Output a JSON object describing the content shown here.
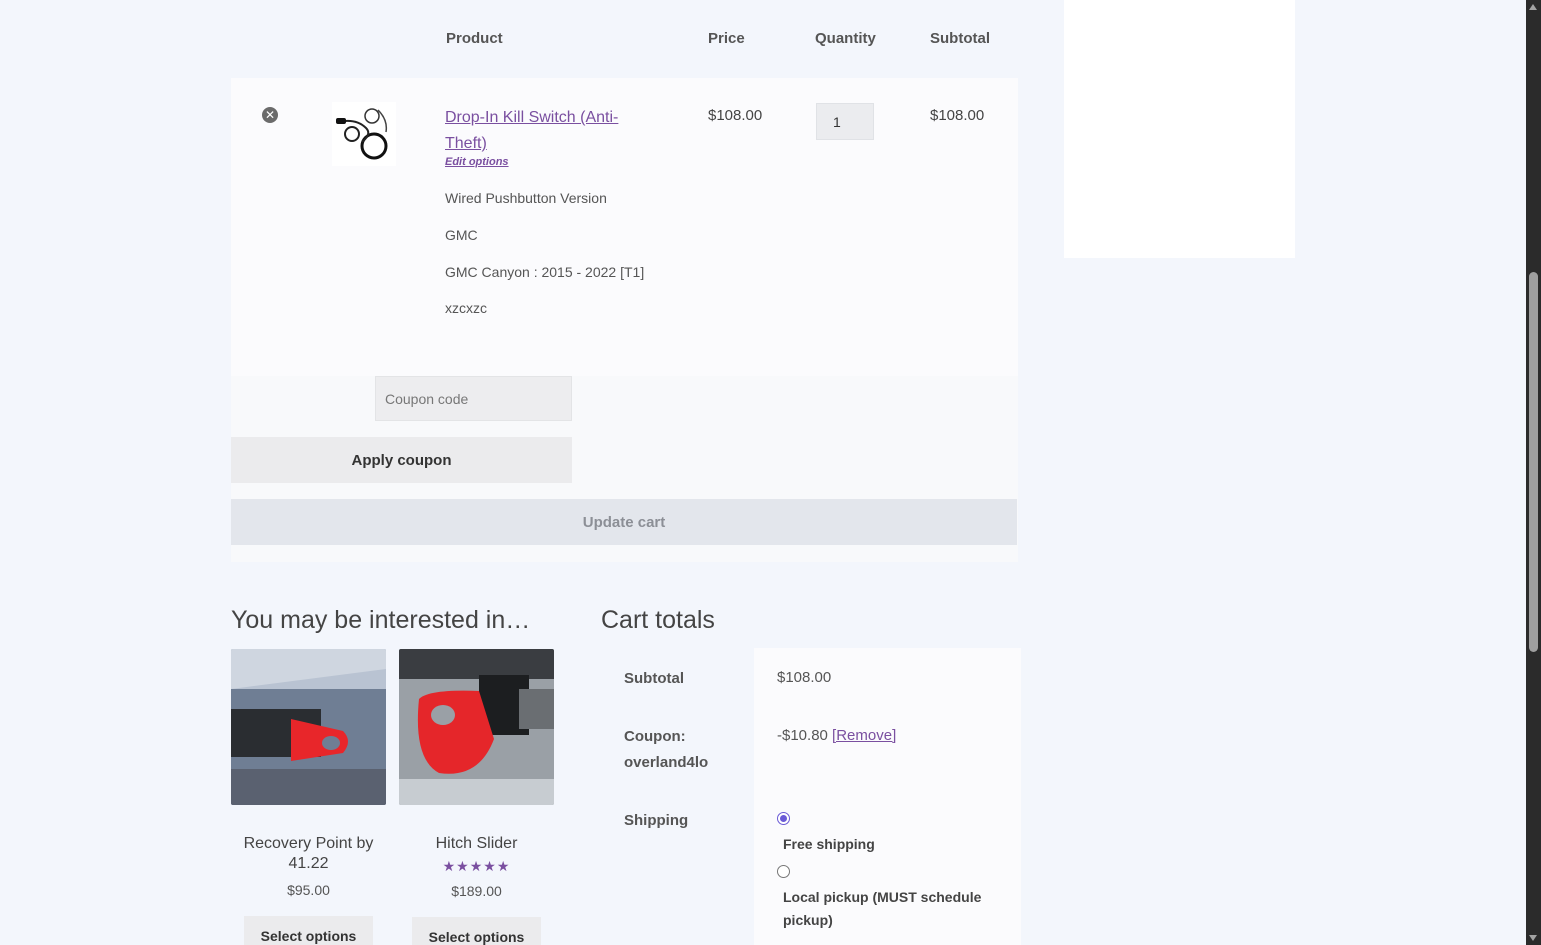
{
  "cart_table": {
    "headers": {
      "product": "Product",
      "price": "Price",
      "quantity": "Quantity",
      "subtotal": "Subtotal"
    },
    "item": {
      "name": "Drop-In Kill Switch (Anti-Theft)",
      "edit_options": "Edit options",
      "meta": [
        "Wired Pushbutton Version",
        "GMC",
        "GMC Canyon : 2015 - 2022 [T1]",
        "xzcxzc"
      ],
      "price": "$108.00",
      "quantity": "1",
      "subtotal": "$108.00"
    }
  },
  "coupon": {
    "placeholder": "Coupon code",
    "apply_label": "Apply coupon",
    "update_label": "Update cart"
  },
  "cross_sells": {
    "title": "You may be interested in…",
    "products": [
      {
        "name": "Recovery Point by 41.22",
        "price": "$95.00",
        "button": "Select options",
        "rating": ""
      },
      {
        "name": "Hitch Slider",
        "price": "$189.00",
        "button": "Select options",
        "rating": "★★★★★"
      }
    ]
  },
  "cart_totals": {
    "title": "Cart totals",
    "subtotal_label": "Subtotal",
    "subtotal_value": "$108.00",
    "coupon_label": "Coupon: overland4lo",
    "coupon_value": "-$10.80",
    "coupon_remove": "[Remove]",
    "shipping_label": "Shipping",
    "shipping_options": [
      {
        "label": "Free shipping",
        "selected": true
      },
      {
        "label": "Local pickup (MUST schedule pickup)",
        "selected": false
      }
    ]
  },
  "colors": {
    "accent": "#7a4fa0",
    "background": "#f3f6fc",
    "radio": "#6b5bd6"
  }
}
